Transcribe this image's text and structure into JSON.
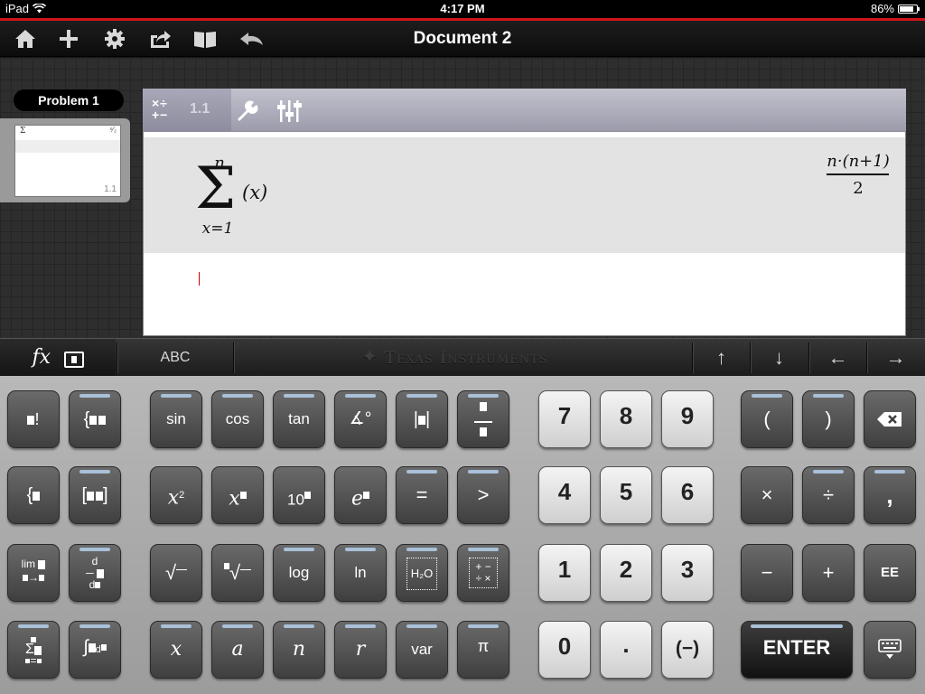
{
  "status": {
    "device": "iPad",
    "time": "4:17 PM",
    "battery": "86%",
    "battery_level": 0.86
  },
  "toolbar": {
    "title": "Document 2",
    "icons": [
      "home-icon",
      "plus-icon",
      "gear-icon",
      "share-icon",
      "book-icon",
      "undo-icon"
    ]
  },
  "sidebar": {
    "problem_label": "Problem 1",
    "thumb_page": "1.1"
  },
  "page_toolbar": {
    "page_number": "1.1"
  },
  "calc": {
    "entry": {
      "upper": "n",
      "lower": "x=1",
      "term": "(x)"
    },
    "result": {
      "numer": "n·(n+1)",
      "denom": "2"
    }
  },
  "kbd_tabs": {
    "fx": "fx",
    "abc": "ABC",
    "brand": "Texas Instruments",
    "up": "↑",
    "down": "↓",
    "left": "←",
    "right": "→"
  },
  "keys": {
    "row1": [
      "sin",
      "cos",
      "tan",
      "7",
      "8",
      "9",
      "(",
      ")"
    ],
    "row2": [
      "=",
      ">",
      "4",
      "5",
      "6",
      "×",
      "÷",
      ","
    ],
    "row3": [
      "log",
      "ln",
      "1",
      "2",
      "3",
      "−",
      "+",
      "EE"
    ],
    "row4": [
      "x",
      "a",
      "n",
      "r",
      "var",
      "π",
      "0",
      ".",
      "(−)",
      "ENTER"
    ],
    "misc": {
      "ten": "10",
      "e": "e",
      "x": "x",
      "xsq_exp": "2",
      "sqrt": "√",
      "nthroot": "√",
      "lim": "lim",
      "d": "d",
      "sigma": "Σ",
      "h2o": "H₂O"
    }
  },
  "colors": {
    "accent_red": "#d0151b",
    "key_bar": "#a9c0d8"
  }
}
